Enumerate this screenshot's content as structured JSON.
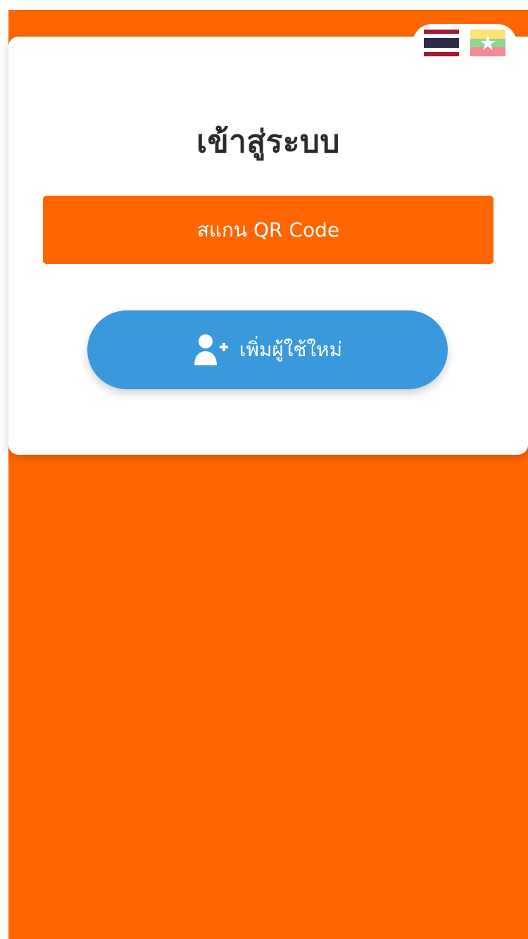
{
  "language_switcher": {
    "thai_flag": "flag-th-icon",
    "myanmar_flag": "flag-mm-icon"
  },
  "login": {
    "title": "เข้าสู่ระบบ",
    "scan_qr_label": "สแกน QR Code",
    "add_user_label": "เพิ่มผู้ใช้ใหม่",
    "add_user_icon": "user-plus-icon"
  },
  "colors": {
    "primary_orange": "#ff6600",
    "button_blue": "#3a99dc",
    "card_bg": "#ffffff"
  }
}
